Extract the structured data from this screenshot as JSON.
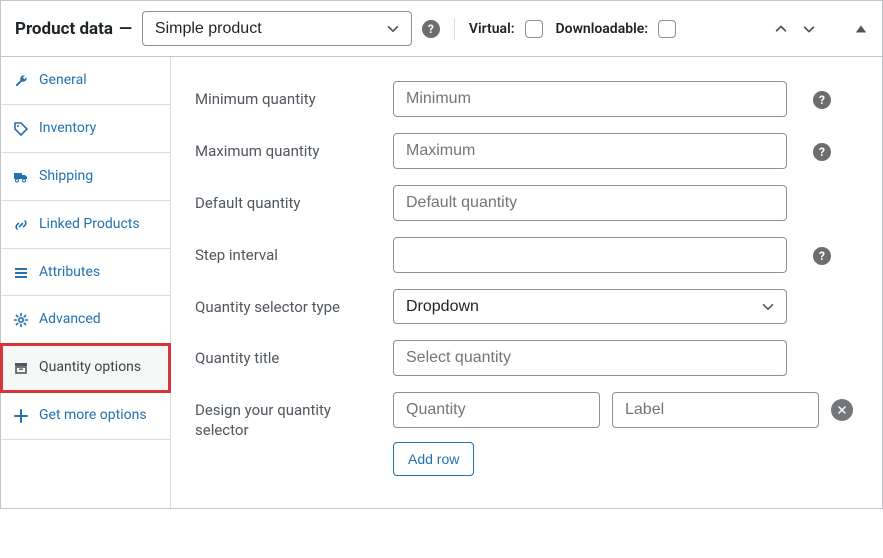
{
  "header": {
    "title": "Product data",
    "product_type": "Simple product",
    "virtual_label": "Virtual:",
    "downloadable_label": "Downloadable:"
  },
  "tabs": {
    "general": "General",
    "inventory": "Inventory",
    "shipping": "Shipping",
    "linked": "Linked Products",
    "attributes": "Attributes",
    "advanced": "Advanced",
    "quantity_options": "Quantity options",
    "get_more": "Get more options"
  },
  "fields": {
    "min_qty_label": "Minimum quantity",
    "min_qty_placeholder": "Minimum",
    "max_qty_label": "Maximum quantity",
    "max_qty_placeholder": "Maximum",
    "default_qty_label": "Default quantity",
    "default_qty_placeholder": "Default quantity",
    "step_label": "Step interval",
    "step_placeholder": "",
    "selector_type_label": "Quantity selector type",
    "selector_type_value": "Dropdown",
    "title_label": "Quantity title",
    "title_placeholder": "Select quantity",
    "design_label": "Design your quantity selector",
    "design_qty_placeholder": "Quantity",
    "design_label_placeholder": "Label",
    "add_row": "Add row"
  }
}
